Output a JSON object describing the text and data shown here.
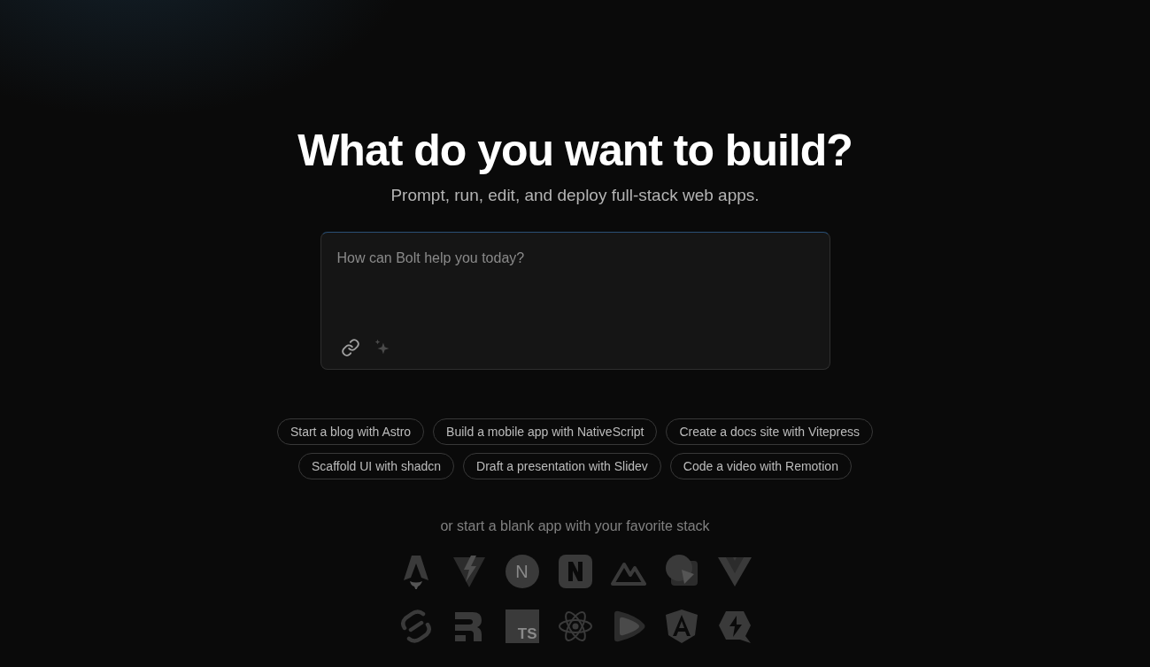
{
  "heading": "What do you want to build?",
  "subheading": "Prompt, run, edit, and deploy full-stack web apps.",
  "prompt": {
    "placeholder": "How can Bolt help you today?"
  },
  "suggestions": [
    {
      "label": "Start a blog with Astro"
    },
    {
      "label": "Build a mobile app with NativeScript"
    },
    {
      "label": "Create a docs site with Vitepress"
    },
    {
      "label": "Scaffold UI with shadcn"
    },
    {
      "label": "Draft a presentation with Slidev"
    },
    {
      "label": "Code a video with Remotion"
    }
  ],
  "stack_hint": "or start a blank app with your favorite stack",
  "stacks": [
    {
      "kind": "astro"
    },
    {
      "kind": "vite"
    },
    {
      "kind": "next",
      "mark": "N"
    },
    {
      "kind": "nativescript"
    },
    {
      "kind": "nuxt"
    },
    {
      "kind": "slidev"
    },
    {
      "kind": "vue"
    },
    {
      "kind": "svelte"
    },
    {
      "kind": "remix"
    },
    {
      "kind": "typescript",
      "mark": "TS"
    },
    {
      "kind": "react"
    },
    {
      "kind": "remotion"
    },
    {
      "kind": "angular"
    },
    {
      "kind": "qwik"
    }
  ]
}
